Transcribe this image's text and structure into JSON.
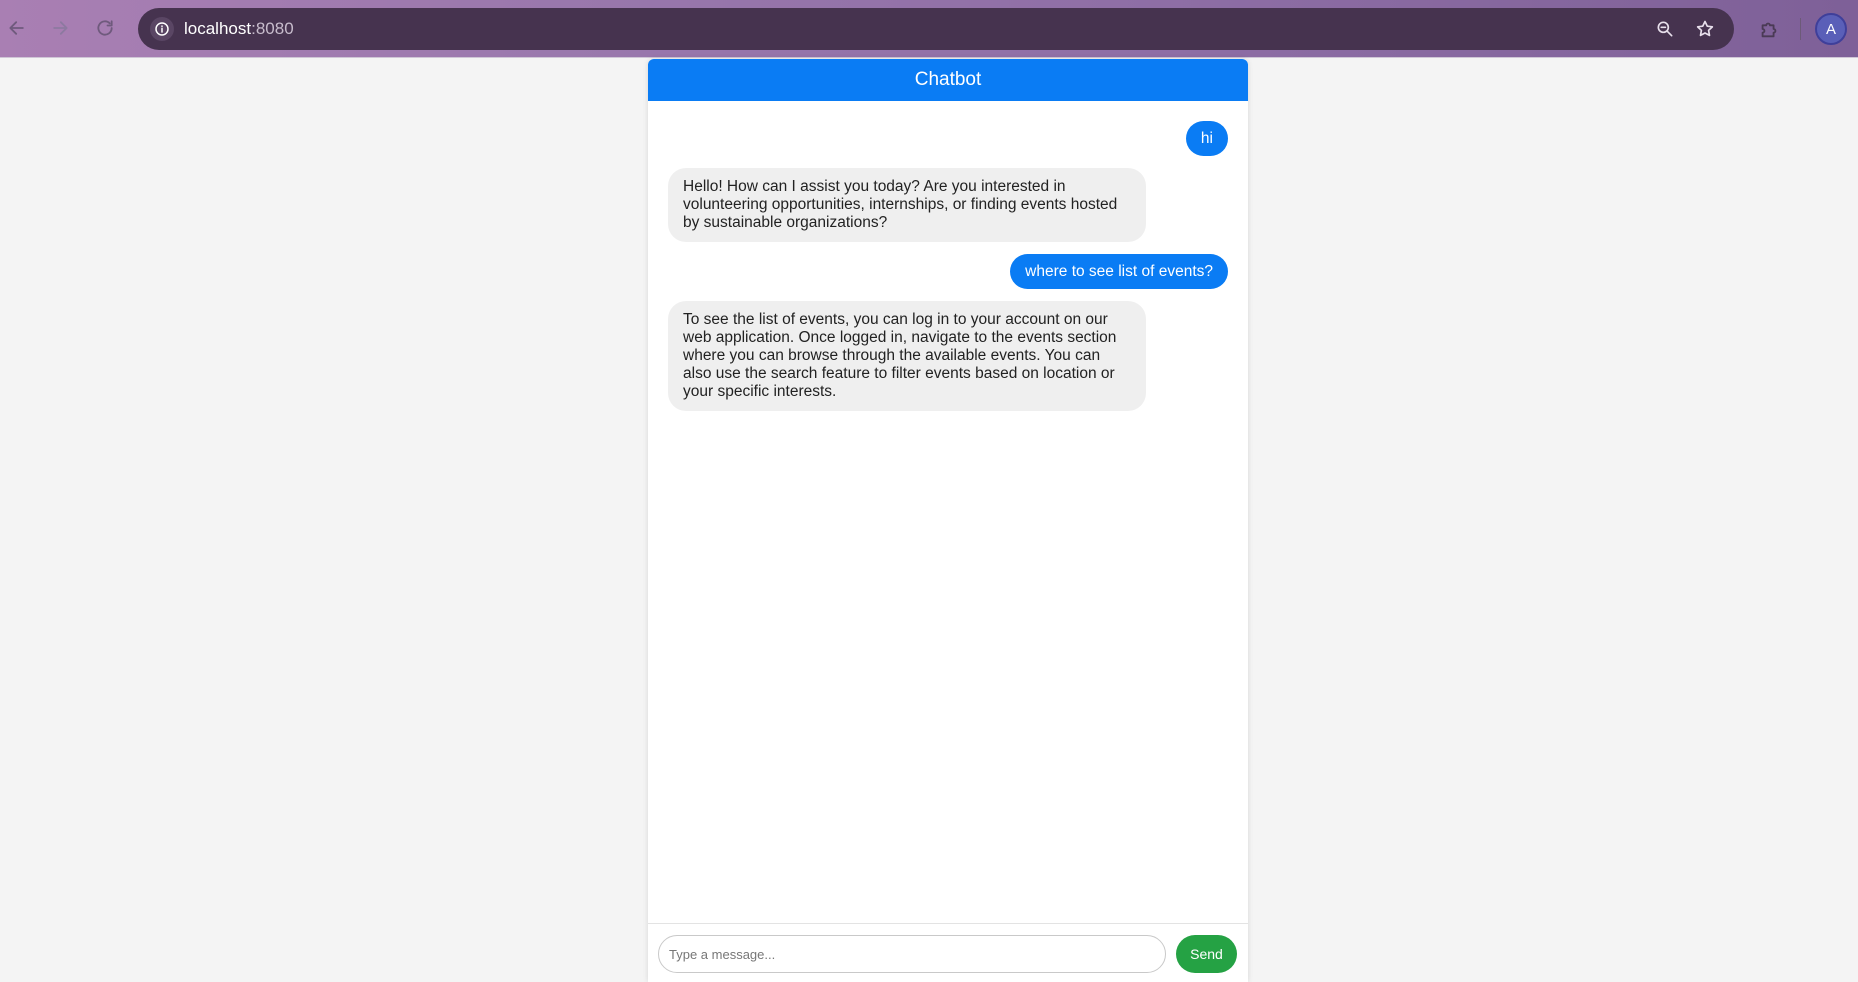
{
  "browser": {
    "url_host": "localhost",
    "url_port": ":8080",
    "avatar_letter": "A",
    "icons": {
      "back": "arrow-left-icon",
      "forward": "arrow-right-icon",
      "reload": "reload-icon",
      "site_info": "info-icon",
      "zoom": "zoom-icon",
      "bookmark": "star-icon",
      "extensions": "puzzle-icon"
    }
  },
  "chat": {
    "title": "Chatbot",
    "accent_color": "#0a7cf4",
    "send_color": "#25a244",
    "messages": [
      {
        "role": "user",
        "text": "hi"
      },
      {
        "role": "bot",
        "text": "Hello! How can I assist you today? Are you interested in volunteering opportunities, internships, or finding events hosted by sustainable organizations?"
      },
      {
        "role": "user",
        "text": "where to see list of events?"
      },
      {
        "role": "bot",
        "text": "To see the list of events, you can log in to your account on our web application. Once logged in, navigate to the events section where you can browse through the available events. You can also use the search feature to filter events based on location or your specific interests."
      }
    ],
    "input": {
      "value": "",
      "placeholder": "Type a message..."
    },
    "send_label": "Send"
  }
}
